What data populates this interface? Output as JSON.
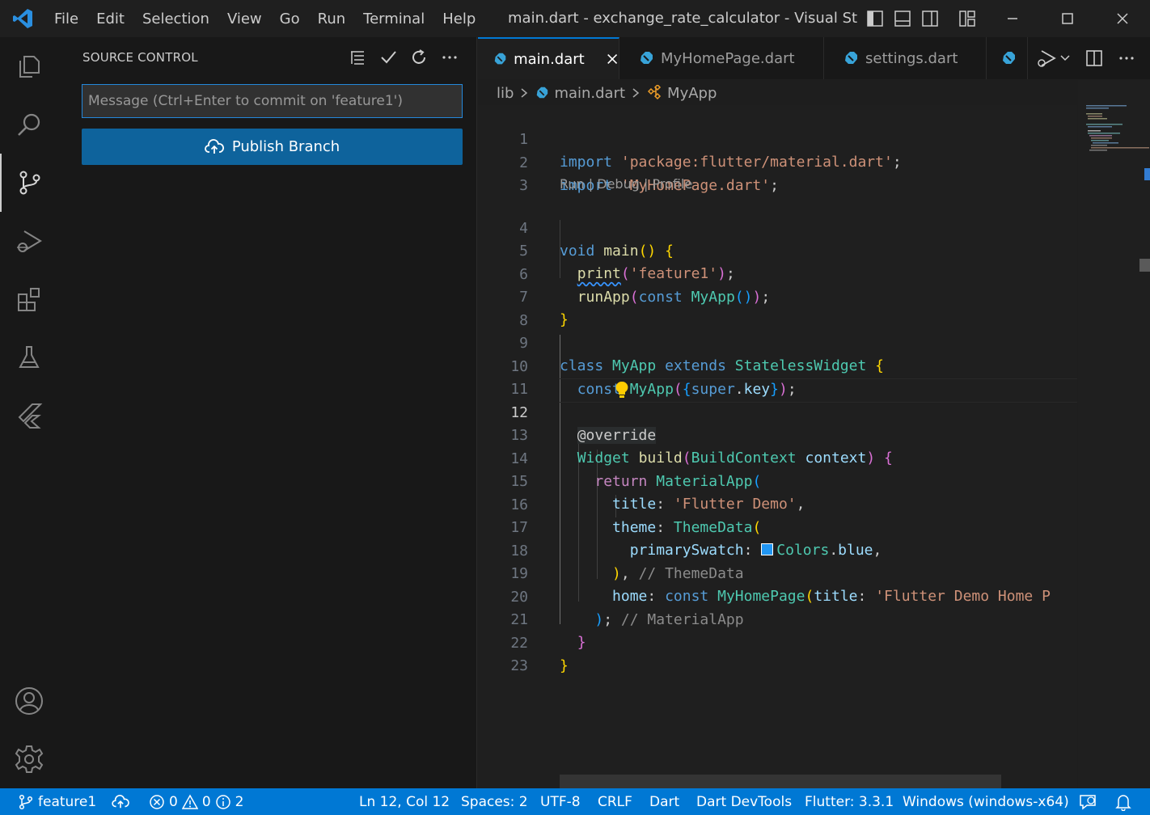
{
  "titlebar": {
    "menu": [
      "File",
      "Edit",
      "Selection",
      "View",
      "Go",
      "Run",
      "Terminal",
      "Help"
    ],
    "window_title": "main.dart - exchange_rate_calculator - Visual Studio ..."
  },
  "sidebar": {
    "title": "SOURCE CONTROL",
    "message_placeholder": "Message (Ctrl+Enter to commit on 'feature1')",
    "publish_label": "Publish Branch"
  },
  "tabs": [
    {
      "label": "main.dart",
      "active": true
    },
    {
      "label": "MyHomePage.dart",
      "active": false
    },
    {
      "label": "settings.dart",
      "active": false
    }
  ],
  "breadcrumb": {
    "folder": "lib",
    "file": "main.dart",
    "symbol": "MyApp"
  },
  "codelens": "Run | Debug | Profile",
  "current_line": 12,
  "line_numbers": [
    "1",
    "2",
    "3",
    "4",
    "5",
    "6",
    "7",
    "8",
    "9",
    "10",
    "11",
    "12",
    "13",
    "14",
    "15",
    "16",
    "17",
    "18",
    "19",
    "20",
    "21",
    "22",
    "23"
  ],
  "code": {
    "l1_kw": "import",
    "l1_str": "'package:flutter/material.dart'",
    "l1_end": ";",
    "l2_kw": "import",
    "l2_str": "'MyHomePage.dart'",
    "l2_end": ";",
    "l4_kw": "void",
    "l4_fn": "main",
    "l4_paren": "()",
    "l4_brace": "{",
    "l5_fn": "print",
    "l5_str": "'feature1'",
    "l5_end": ";",
    "l6_fn": "runApp",
    "l6_kw": "const",
    "l6_cls": "MyApp",
    "l6_end": ";",
    "l7_brace": "}",
    "l9_kw": "class",
    "l9_cls": "MyApp",
    "l9_kw2": "extends",
    "l9_cls2": "StatelessWidget",
    "l9_brace": "{",
    "l10_kw": "const",
    "l10_cls": "MyApp",
    "l10_kw2": "super",
    "l10_prop": "key",
    "l10_end": ";",
    "l12_ann": "@override",
    "l13_cls": "Widget",
    "l13_fn": "build",
    "l13_cls2": "BuildContext",
    "l13_param": "context",
    "l13_brace": "{",
    "l14_kw": "return",
    "l14_cls": "MaterialApp",
    "l15_prop": "title",
    "l15_str": "'Flutter Demo'",
    "l16_prop": "theme",
    "l16_cls": "ThemeData",
    "l17_prop": "primarySwatch",
    "l17_cls": "Colors",
    "l17_prop2": "blue",
    "l18_cmt": "// ThemeData",
    "l19_prop": "home",
    "l19_kw": "const",
    "l19_cls": "MyHomePage",
    "l19_prop2": "title",
    "l19_str": "'Flutter Demo Home P",
    "l20_cmt": "// MaterialApp",
    "l21_brace": "}",
    "l22_brace": "}"
  },
  "status": {
    "branch": "feature1",
    "errors": "0",
    "warnings": "0",
    "infos": "2",
    "position": "Ln 12, Col 12",
    "spaces": "Spaces: 2",
    "encoding": "UTF-8",
    "eol": "CRLF",
    "language": "Dart",
    "devtools": "Dart DevTools",
    "flutter": "Flutter: 3.3.1",
    "device": "Windows (windows-x64)"
  },
  "colors": {
    "accent": "#0078d4",
    "button": "#0e639c",
    "swatch": "#2196f3"
  }
}
